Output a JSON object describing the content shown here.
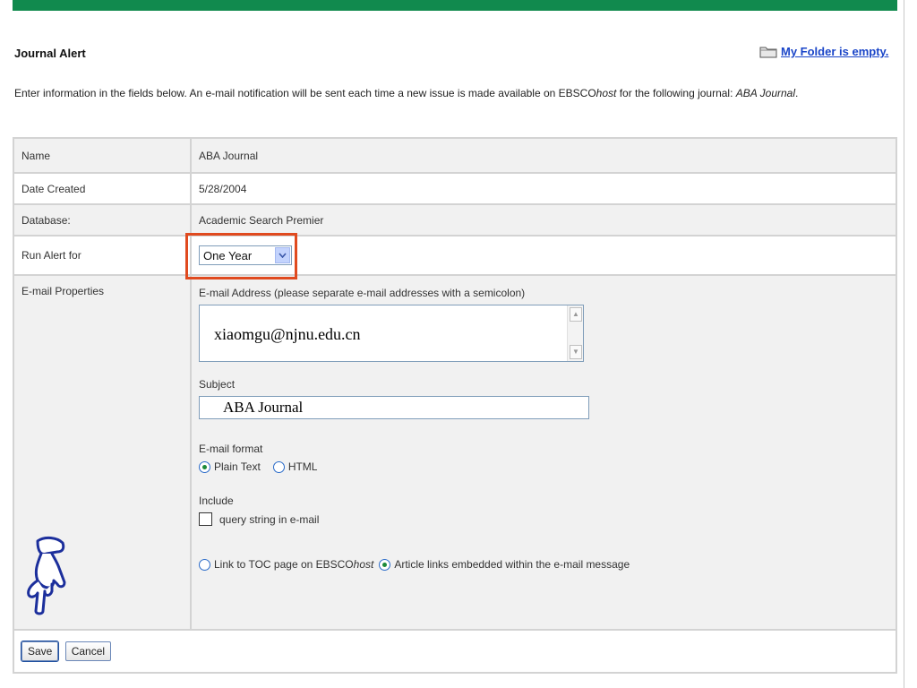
{
  "header": {
    "title": "Journal Alert",
    "folder_link": "My Folder is empty.",
    "intro_prefix": "Enter information in the fields below. An e-mail notification will be sent each time a new issue is made available on EBSCO",
    "intro_host": "host",
    "intro_middle": " for the following journal: ",
    "intro_journal": "ABA Journal",
    "intro_suffix": "."
  },
  "form": {
    "name_label": "Name",
    "name_value": "ABA Journal",
    "date_label": "Date Created",
    "date_value": "5/28/2004",
    "database_label": "Database:",
    "database_value": "Academic Search Premier",
    "run_alert_label": "Run Alert for",
    "run_alert_value": "One Year",
    "email_props_label": "E-mail Properties",
    "email_address_label": "E-mail Address (please separate e-mail addresses with a semicolon)",
    "email_address_value": "xiaomgu@njnu.edu.cn",
    "subject_label": "Subject",
    "subject_value": "ABA Journal",
    "format_label": "E-mail format",
    "format_options": [
      "Plain Text",
      "HTML"
    ],
    "format_selected": "Plain Text",
    "include_label": "Include",
    "include_query": "query string in e-mail",
    "toc_link_prefix": "Link to TOC page on EBSCO",
    "toc_link_host": "host",
    "article_links": "Article links embedded within the e-mail message",
    "link_selected": "Article links embedded within the e-mail message"
  },
  "buttons": {
    "save": "Save",
    "cancel": "Cancel"
  },
  "colors": {
    "top_bar": "#118a4e",
    "highlight": "#e04a1f",
    "link": "#1a45c8"
  }
}
